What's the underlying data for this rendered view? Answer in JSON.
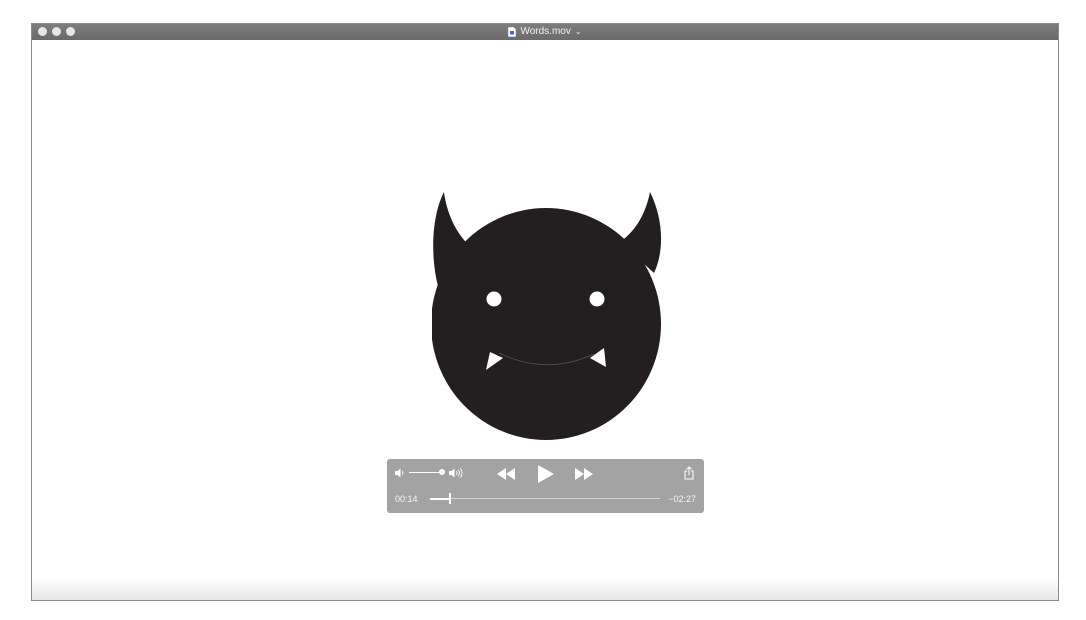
{
  "window": {
    "title": "Words.mov",
    "title_icon": "document-icon",
    "title_menu_icon": "chevron-down-icon",
    "traffic_lights": [
      "close",
      "minimize",
      "zoom"
    ]
  },
  "video": {
    "content": "devil-emoji"
  },
  "controls": {
    "elapsed": "00:14",
    "remaining": "−02:27",
    "progress_fraction": 0.087,
    "volume_fraction": 0.95,
    "icons": {
      "volume_low": "speaker-low-icon",
      "volume_high": "speaker-high-icon",
      "rewind": "rewind-icon",
      "play": "play-icon",
      "fast_forward": "fast-forward-icon",
      "share": "share-icon"
    }
  },
  "colors": {
    "titlebar": "#6f6f6f",
    "hud_background": "#969696",
    "devil_fill": "#231f20",
    "stage_background": "#ffffff"
  }
}
